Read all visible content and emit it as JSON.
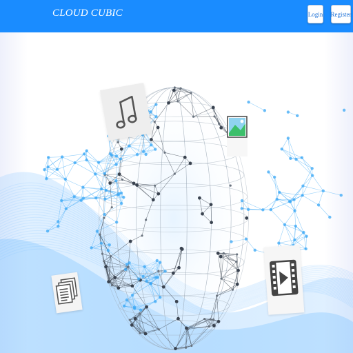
{
  "navbar": {
    "brand": "CLOUD CUBIC",
    "login_label": "Login",
    "register_label": "Register",
    "background_color": "#1a8cff"
  },
  "hero": {
    "illustration": "network-globe",
    "icons": [
      "music-note-icon",
      "image-icon",
      "document-icon",
      "video-icon"
    ],
    "accent_color": "#3ba8f5"
  }
}
